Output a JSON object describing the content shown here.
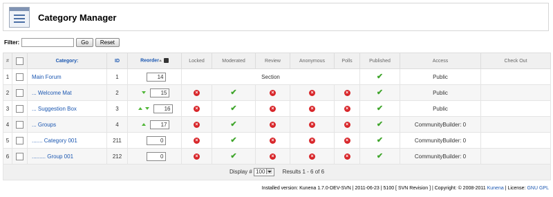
{
  "header": {
    "title": "Category Manager",
    "icon": "category-manager-icon"
  },
  "filter": {
    "label": "Filter:",
    "value": "",
    "go": "Go",
    "reset": "Reset"
  },
  "columns": {
    "num": "#",
    "category": "Category:",
    "id": "ID",
    "reorder": "Reorder",
    "locked": "Locked",
    "moderated": "Moderated",
    "review": "Review",
    "anonymous": "Anonymous",
    "polls": "Polls",
    "published": "Published",
    "access": "Access",
    "checkout": "Check Out"
  },
  "rows": [
    {
      "num": "1",
      "category": "Main Forum",
      "id": "1",
      "order": "14",
      "up": false,
      "down": false,
      "section_label": "Section",
      "locked": null,
      "moderated": null,
      "review": null,
      "anonymous": null,
      "polls": null,
      "published": true,
      "access": "Public"
    },
    {
      "num": "2",
      "category": "... Welcome Mat",
      "id": "2",
      "order": "15",
      "up": false,
      "down": true,
      "locked": "no",
      "moderated": "yes",
      "review": "no",
      "anonymous": "no",
      "polls": "no",
      "published": true,
      "access": "Public"
    },
    {
      "num": "3",
      "category": "... Suggestion Box",
      "id": "3",
      "order": "16",
      "up": true,
      "down": true,
      "locked": "no",
      "moderated": "yes",
      "review": "no",
      "anonymous": "no",
      "polls": "no",
      "published": true,
      "access": "Public"
    },
    {
      "num": "4",
      "category": "... Groups",
      "id": "4",
      "order": "17",
      "up": true,
      "down": false,
      "locked": "no",
      "moderated": "yes",
      "review": "no",
      "anonymous": "no",
      "polls": "no",
      "published": true,
      "access": "CommunityBuilder: 0"
    },
    {
      "num": "5",
      "category": "....... Category 001",
      "id": "211",
      "order": "0",
      "up": false,
      "down": false,
      "locked": "no",
      "moderated": "yes",
      "review": "no",
      "anonymous": "no",
      "polls": "no",
      "published": true,
      "access": "CommunityBuilder: 0"
    },
    {
      "num": "6",
      "category": "......... Group 001",
      "id": "212",
      "order": "0",
      "up": false,
      "down": false,
      "locked": "no",
      "moderated": "yes",
      "review": "no",
      "anonymous": "no",
      "polls": "no",
      "published": true,
      "access": "CommunityBuilder: 0"
    }
  ],
  "pagination": {
    "display_label": "Display #",
    "display_value": "100",
    "results": "Results 1 - 6 of 6"
  },
  "footer": {
    "prefix": "Installed version:",
    "version": "Kunena 1.7.0-DEV-SVN | 2011-06-23 | 5100 [ SVN Revision ] | Copyright: © 2008-2011",
    "kunena_link": "Kunena",
    "license_label": "| License:",
    "license_link": "GNU GPL"
  },
  "colors": {
    "link": "#1b57b1",
    "ok": "#3fa52b",
    "no": "#d8262a",
    "arrow": "#4fb636"
  }
}
